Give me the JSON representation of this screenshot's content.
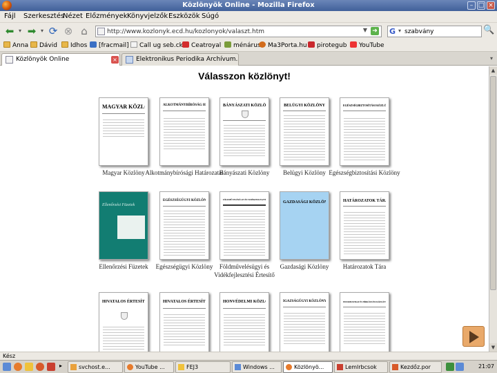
{
  "window": {
    "title": "Közlönyök Online - Mozilla Firefox"
  },
  "menu": [
    "Fájl",
    "Szerkesztés",
    "Nézet",
    "Előzmények",
    "Könyvjelzők",
    "Eszközök",
    "Súgó"
  ],
  "nav": {
    "url": "http://www.kozlonyk.ecd.hu/kozlonyok/valaszt.htm",
    "search_value": "szabvány"
  },
  "bookmarks": [
    "Anna",
    "Dávid",
    "Idhos",
    "[fracmail]",
    "Call ug seb.ck",
    "Ceatroyal",
    "ménárus",
    "Ma3Porta.hu",
    "pirotegub",
    "YouTube"
  ],
  "tabs": [
    {
      "label": "Közlönyök Online",
      "active": true
    },
    {
      "label": "Elektronikus Periodika Archívum..."
    }
  ],
  "page": {
    "heading": "Válasszon közlönyt!",
    "books": [
      {
        "label": "Magyar Közlöny",
        "masthead": "MAGYAR KÖZLÖNY"
      },
      {
        "label": "Alkotmánybírósági Határozatai",
        "masthead": "ALKOTMÁNYBÍRÓSÁG HATÁROZATAI"
      },
      {
        "label": "Bányászati Közlöny",
        "masthead": "BÁNYÁSZATI KÖZLÖNY"
      },
      {
        "label": "Belügyi Közlöny",
        "masthead": "BELÜGYI KÖZLÖNY"
      },
      {
        "label": "Egészségbiztosítási Közlöny",
        "masthead": "EGÉSZSÉGBIZTOSÍTÁSI KÖZLÖNY"
      },
      {
        "label": "Ellenőrzési Füzetek",
        "masthead": "Ellenőrzési Füzetek"
      },
      {
        "label": "Egészségügyi Közlöny",
        "masthead": "EGÉSZSÉGÜGYI KÖZLÖNY"
      },
      {
        "label": "Földművelésügyi és Vidékfejlesztési Értesítő",
        "masthead": "FÖLDMŰVELÉSÜGYI ÉS VIDÉKFEJLESZTÉSI ÉRTESÍTŐ"
      },
      {
        "label": "Gazdasági Közlöny",
        "masthead": "GAZDASÁGI KÖZLÖNY"
      },
      {
        "label": "Határozatok Tára",
        "masthead": "HATÁROZATOK TÁRA"
      },
      {
        "label": "",
        "masthead": "HIVATALOS ÉRTESÍTŐ"
      },
      {
        "label": "",
        "masthead": "HIVATALOS ÉRTESÍTŐ"
      },
      {
        "label": "",
        "masthead": "HONVÉDELMI KÖZLÖNY"
      },
      {
        "label": "",
        "masthead": "IGAZSÁGÜGYI KÖZLÖNY"
      },
      {
        "label": "",
        "masthead": "INFORMATIKAI ÉS HÍRKÖZLÉSI KÖZLÖNY"
      }
    ]
  },
  "status": "Kész",
  "taskbar": {
    "items": [
      "svchost.e...",
      "YouTube ...",
      "FEJ3",
      "Windows ...",
      "Közlönyö...",
      "Lemlrbcsok",
      "Kezdőz.por"
    ],
    "clock": "21:07"
  }
}
